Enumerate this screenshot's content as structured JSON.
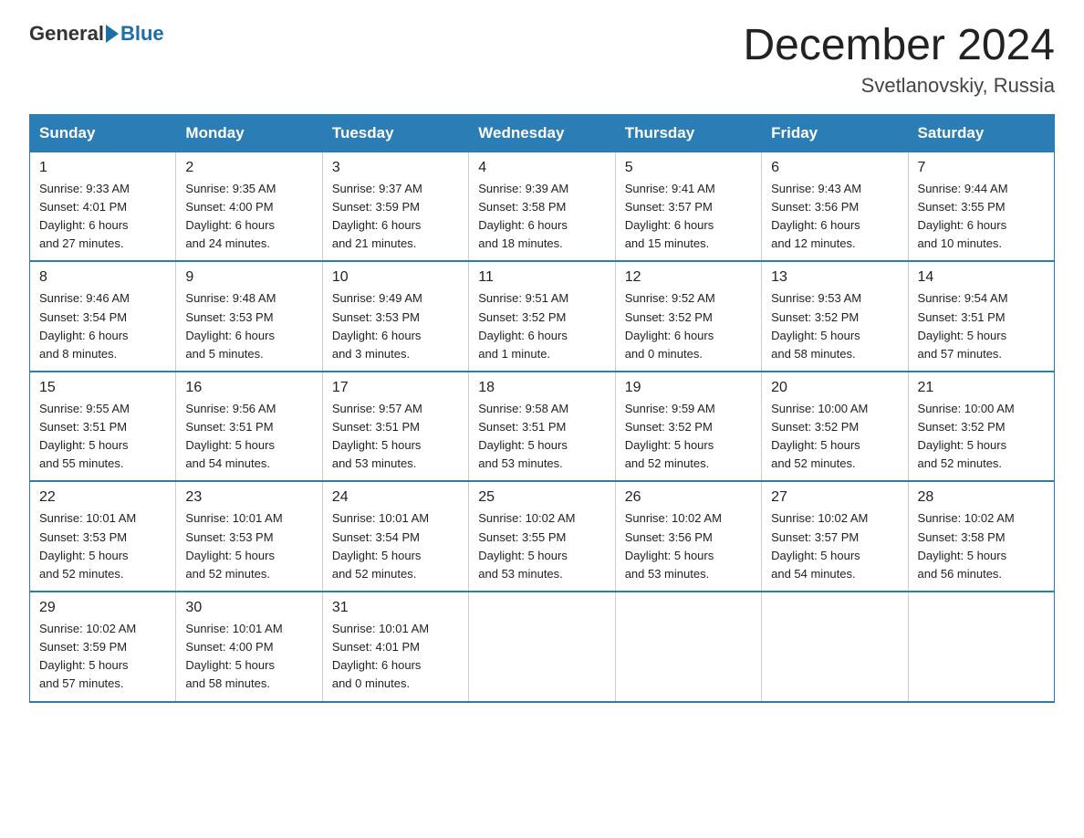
{
  "header": {
    "logo_general": "General",
    "logo_blue": "Blue",
    "month_title": "December 2024",
    "location": "Svetlanovskiy, Russia"
  },
  "days_of_week": [
    "Sunday",
    "Monday",
    "Tuesday",
    "Wednesday",
    "Thursday",
    "Friday",
    "Saturday"
  ],
  "weeks": [
    [
      {
        "num": "1",
        "info": "Sunrise: 9:33 AM\nSunset: 4:01 PM\nDaylight: 6 hours\nand 27 minutes."
      },
      {
        "num": "2",
        "info": "Sunrise: 9:35 AM\nSunset: 4:00 PM\nDaylight: 6 hours\nand 24 minutes."
      },
      {
        "num": "3",
        "info": "Sunrise: 9:37 AM\nSunset: 3:59 PM\nDaylight: 6 hours\nand 21 minutes."
      },
      {
        "num": "4",
        "info": "Sunrise: 9:39 AM\nSunset: 3:58 PM\nDaylight: 6 hours\nand 18 minutes."
      },
      {
        "num": "5",
        "info": "Sunrise: 9:41 AM\nSunset: 3:57 PM\nDaylight: 6 hours\nand 15 minutes."
      },
      {
        "num": "6",
        "info": "Sunrise: 9:43 AM\nSunset: 3:56 PM\nDaylight: 6 hours\nand 12 minutes."
      },
      {
        "num": "7",
        "info": "Sunrise: 9:44 AM\nSunset: 3:55 PM\nDaylight: 6 hours\nand 10 minutes."
      }
    ],
    [
      {
        "num": "8",
        "info": "Sunrise: 9:46 AM\nSunset: 3:54 PM\nDaylight: 6 hours\nand 8 minutes."
      },
      {
        "num": "9",
        "info": "Sunrise: 9:48 AM\nSunset: 3:53 PM\nDaylight: 6 hours\nand 5 minutes."
      },
      {
        "num": "10",
        "info": "Sunrise: 9:49 AM\nSunset: 3:53 PM\nDaylight: 6 hours\nand 3 minutes."
      },
      {
        "num": "11",
        "info": "Sunrise: 9:51 AM\nSunset: 3:52 PM\nDaylight: 6 hours\nand 1 minute."
      },
      {
        "num": "12",
        "info": "Sunrise: 9:52 AM\nSunset: 3:52 PM\nDaylight: 6 hours\nand 0 minutes."
      },
      {
        "num": "13",
        "info": "Sunrise: 9:53 AM\nSunset: 3:52 PM\nDaylight: 5 hours\nand 58 minutes."
      },
      {
        "num": "14",
        "info": "Sunrise: 9:54 AM\nSunset: 3:51 PM\nDaylight: 5 hours\nand 57 minutes."
      }
    ],
    [
      {
        "num": "15",
        "info": "Sunrise: 9:55 AM\nSunset: 3:51 PM\nDaylight: 5 hours\nand 55 minutes."
      },
      {
        "num": "16",
        "info": "Sunrise: 9:56 AM\nSunset: 3:51 PM\nDaylight: 5 hours\nand 54 minutes."
      },
      {
        "num": "17",
        "info": "Sunrise: 9:57 AM\nSunset: 3:51 PM\nDaylight: 5 hours\nand 53 minutes."
      },
      {
        "num": "18",
        "info": "Sunrise: 9:58 AM\nSunset: 3:51 PM\nDaylight: 5 hours\nand 53 minutes."
      },
      {
        "num": "19",
        "info": "Sunrise: 9:59 AM\nSunset: 3:52 PM\nDaylight: 5 hours\nand 52 minutes."
      },
      {
        "num": "20",
        "info": "Sunrise: 10:00 AM\nSunset: 3:52 PM\nDaylight: 5 hours\nand 52 minutes."
      },
      {
        "num": "21",
        "info": "Sunrise: 10:00 AM\nSunset: 3:52 PM\nDaylight: 5 hours\nand 52 minutes."
      }
    ],
    [
      {
        "num": "22",
        "info": "Sunrise: 10:01 AM\nSunset: 3:53 PM\nDaylight: 5 hours\nand 52 minutes."
      },
      {
        "num": "23",
        "info": "Sunrise: 10:01 AM\nSunset: 3:53 PM\nDaylight: 5 hours\nand 52 minutes."
      },
      {
        "num": "24",
        "info": "Sunrise: 10:01 AM\nSunset: 3:54 PM\nDaylight: 5 hours\nand 52 minutes."
      },
      {
        "num": "25",
        "info": "Sunrise: 10:02 AM\nSunset: 3:55 PM\nDaylight: 5 hours\nand 53 minutes."
      },
      {
        "num": "26",
        "info": "Sunrise: 10:02 AM\nSunset: 3:56 PM\nDaylight: 5 hours\nand 53 minutes."
      },
      {
        "num": "27",
        "info": "Sunrise: 10:02 AM\nSunset: 3:57 PM\nDaylight: 5 hours\nand 54 minutes."
      },
      {
        "num": "28",
        "info": "Sunrise: 10:02 AM\nSunset: 3:58 PM\nDaylight: 5 hours\nand 56 minutes."
      }
    ],
    [
      {
        "num": "29",
        "info": "Sunrise: 10:02 AM\nSunset: 3:59 PM\nDaylight: 5 hours\nand 57 minutes."
      },
      {
        "num": "30",
        "info": "Sunrise: 10:01 AM\nSunset: 4:00 PM\nDaylight: 5 hours\nand 58 minutes."
      },
      {
        "num": "31",
        "info": "Sunrise: 10:01 AM\nSunset: 4:01 PM\nDaylight: 6 hours\nand 0 minutes."
      },
      {
        "num": "",
        "info": ""
      },
      {
        "num": "",
        "info": ""
      },
      {
        "num": "",
        "info": ""
      },
      {
        "num": "",
        "info": ""
      }
    ]
  ]
}
